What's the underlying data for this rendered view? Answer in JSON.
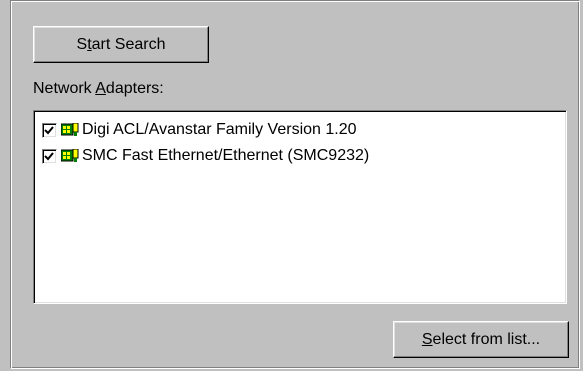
{
  "buttons": {
    "start_search": {
      "pre": "S",
      "accel": "t",
      "post": "art Search"
    },
    "select_from_list": {
      "pre": "",
      "accel": "S",
      "post": "elect from list..."
    }
  },
  "adapters_label": {
    "pre": "Network ",
    "accel": "A",
    "post": "dapters:"
  },
  "adapters": [
    {
      "label": "Digi ACL/Avanstar Family Version 1.20",
      "checked": true,
      "icon": "network-card-icon"
    },
    {
      "label": "SMC Fast Ethernet/Ethernet (SMC9232)",
      "checked": true,
      "icon": "network-card-icon"
    }
  ],
  "colors": {
    "face": "#c0c0c0",
    "nic_green": "#008000",
    "nic_yellow": "#ffff00"
  }
}
